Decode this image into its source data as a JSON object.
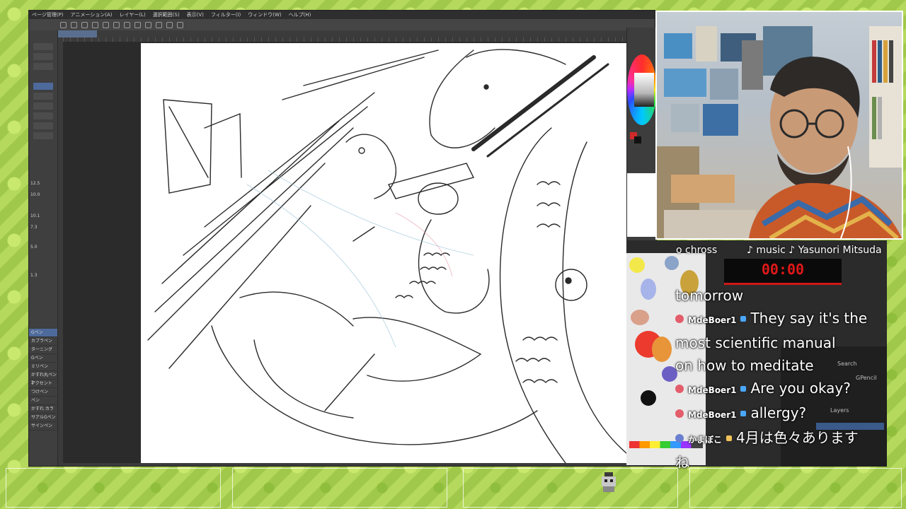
{
  "app": {
    "menu": [
      "ページ管理(P)",
      "アニメーション(A)",
      "レイヤー(L)",
      "選択範囲(S)",
      "表示(V)",
      "フィルター(I)",
      "ウィンドウ(W)",
      "ヘルプ(H)"
    ],
    "tool_properties": [
      "12.5",
      "10.0",
      "10.1",
      "7.3",
      "5.0",
      "1.3"
    ],
    "subtools": [
      "Gペン",
      "カブラペン",
      "ターニング",
      "Gペン",
      "ミリペン",
      "かすれ丸ペン2",
      "アクセント",
      "つけペン",
      "ペン",
      "かすれ カラー",
      "リアルGペン",
      "サインペン"
    ],
    "accent_color": "#4d6a9b"
  },
  "overlay": {
    "credit_left": "o chross",
    "credit_right": "♪ music ♪ Yasunori Mitsuda",
    "timer": "00:00",
    "timer_color": "#e01818",
    "blender": {
      "search_placeholder": "Search",
      "object_label": "GPencil",
      "layers_label": "Layers"
    }
  },
  "chat": {
    "messages": [
      {
        "user": "",
        "text": "tomorrow"
      },
      {
        "user": "MdeBoer1",
        "text": "They say it's the"
      },
      {
        "user": "",
        "text": "most scientific manual"
      },
      {
        "user": "",
        "text": "on how to meditate"
      },
      {
        "user": "MdeBoer1",
        "text": "Are you okay?"
      },
      {
        "user": "MdeBoer1",
        "text": "allergy?"
      },
      {
        "user": "かまぼこ",
        "text": "4月は色々あります"
      },
      {
        "user": "",
        "text": "ね"
      }
    ]
  }
}
